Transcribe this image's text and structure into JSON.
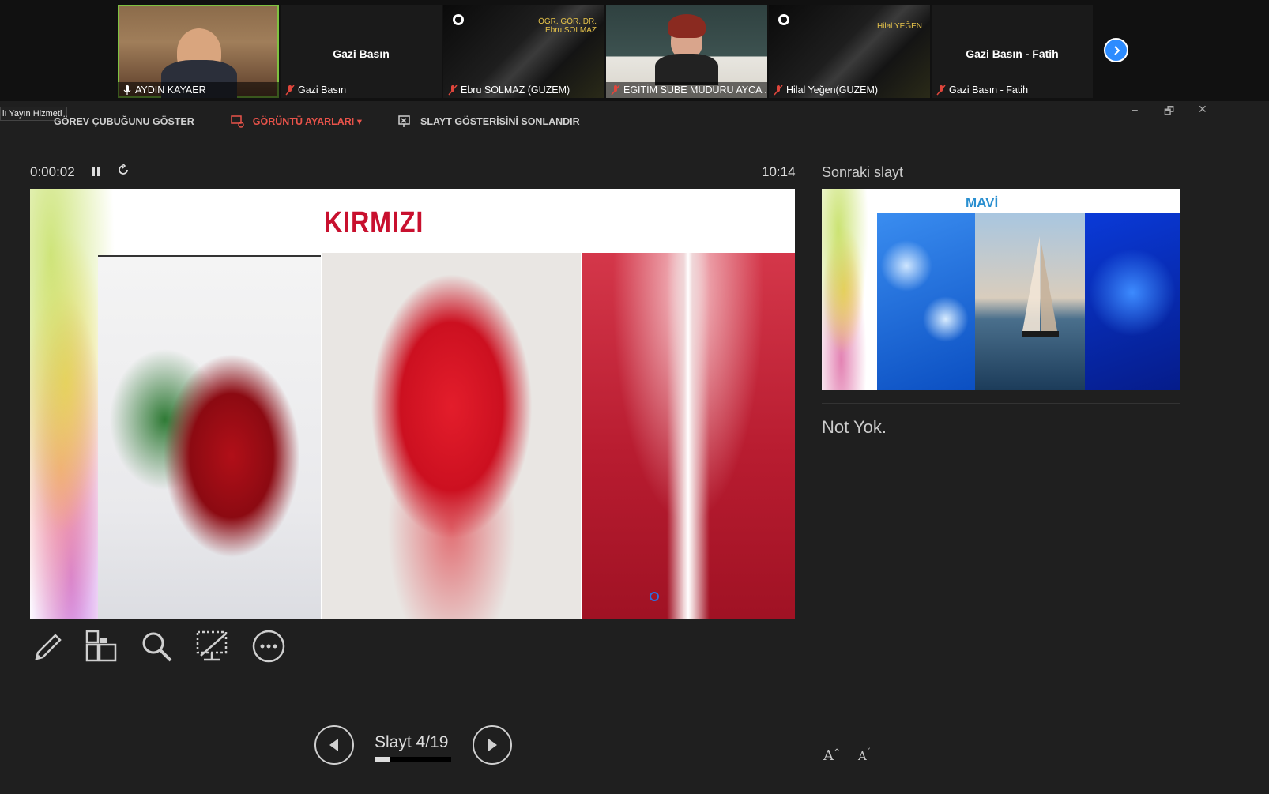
{
  "participants": [
    {
      "name": "AYDIN KAYAER",
      "muted": false,
      "video": "office"
    },
    {
      "name": "Gazi Basın",
      "center_name": "Gazi Basın",
      "muted": true,
      "video": "none"
    },
    {
      "name": "Ebru SOLMAZ (GUZEM)",
      "muted": true,
      "video": "banner",
      "banner_text": "ÖĞR. GÖR. DR.\nEbru SOLMAZ"
    },
    {
      "name": "EGİTİM SUBE MUDURU AYCA ...",
      "muted": true,
      "video": "room"
    },
    {
      "name": "Hilal Yeğen(GUZEM)",
      "muted": true,
      "video": "banner",
      "banner_text": "Hilal YEĞEN"
    },
    {
      "name": "Gazi Basın - Fatih",
      "center_name": "Gazi Basın - Fatih",
      "muted": true,
      "video": "none"
    }
  ],
  "strip_next_icon": "chevron-right-icon",
  "toolbar": {
    "tooltip": "lı Yayın Hizmeti",
    "show_taskbar": "GÖREV ÇUBUĞUNU GÖSTER",
    "display_settings": "GÖRÜNTÜ AYARLARI ▾",
    "end_slideshow": "SLAYT GÖSTERİSİNİ SONLANDIR"
  },
  "window_controls": {
    "minimize": "–",
    "restore": "🗗",
    "close": "✕"
  },
  "timer": "0:00:02",
  "clock": "10:14",
  "current_slide": {
    "title": "KIRMIZI"
  },
  "next_slide": {
    "label": "Sonraki slayt",
    "title": "MAVİ"
  },
  "notes": "Not Yok.",
  "slide_counter": "Slayt 4/19",
  "progress": 0.21,
  "colors": {
    "background": "#1f1f1f",
    "accent_red": "#e8534a",
    "title_red": "#c8102e",
    "zoom_blue": "#2d8cff"
  }
}
